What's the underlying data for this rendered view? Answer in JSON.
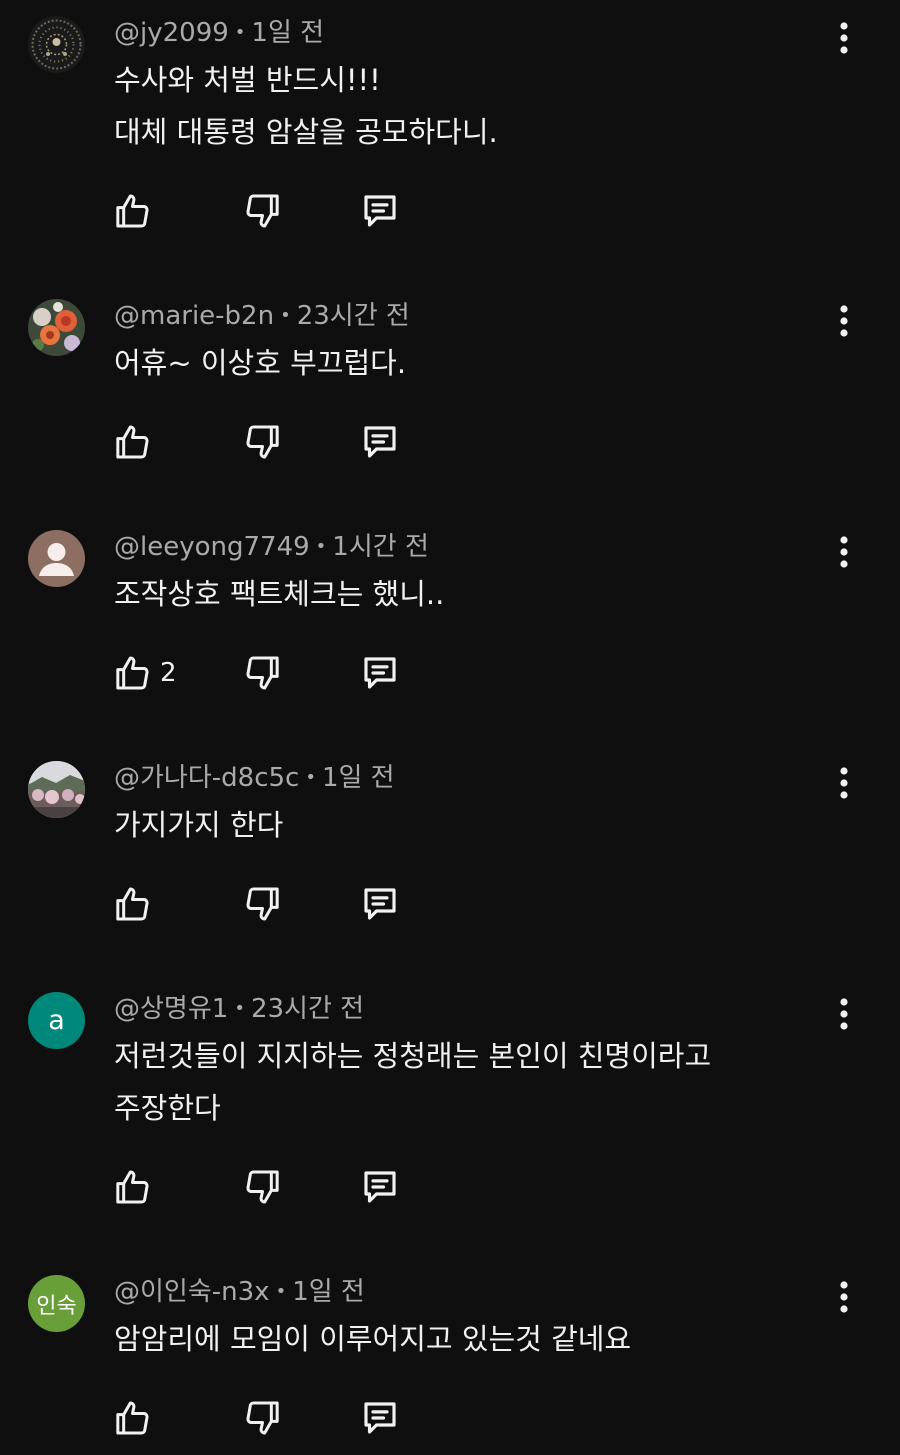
{
  "comments": [
    {
      "handle": "@jy2099",
      "time": "1일 전",
      "lines": [
        "수사와 처벌 반드시!!!",
        "대체 대통령 암살을 공모하다니."
      ],
      "likes": "",
      "avatar": {
        "type": "image",
        "icon": "dark-pattern-avatar"
      }
    },
    {
      "handle": "@marie-b2n",
      "time": "23시간 전",
      "lines": [
        "어휴~ 이상호 부끄럽다."
      ],
      "likes": "",
      "avatar": {
        "type": "image",
        "icon": "flowers-avatar"
      }
    },
    {
      "handle": "@leeyong7749",
      "time": "1시간 전",
      "lines": [
        "조작상호 팩트체크는 했니.."
      ],
      "likes": "2",
      "avatar": {
        "type": "image",
        "icon": "default-person-avatar"
      }
    },
    {
      "handle": "@가나다-d8c5c",
      "time": "1일 전",
      "lines": [
        "가지가지 한다"
      ],
      "likes": "",
      "avatar": {
        "type": "image",
        "icon": "landscape-avatar"
      }
    },
    {
      "handle": "@상명유1",
      "time": "23시간 전",
      "lines": [
        "저런것들이 지지하는 정청래는 본인이 친명이라고",
        "주장한다"
      ],
      "likes": "",
      "avatar": {
        "type": "letter",
        "text": "a",
        "color": "#00897b"
      }
    },
    {
      "handle": "@이인숙-n3x",
      "time": "1일 전",
      "lines": [
        "암암리에 모임이 이루어지고 있는것 같네요"
      ],
      "likes": "",
      "avatar": {
        "type": "letter",
        "text": "인숙",
        "color": "#689f38"
      }
    }
  ],
  "separator": "•",
  "icons": {
    "like": "thumbs-up-icon",
    "dislike": "thumbs-down-icon",
    "reply": "reply-comment-icon",
    "more": "more-vertical-icon"
  },
  "colors": {
    "background": "#0f0f0f",
    "text": "#f1f1f1",
    "meta": "#aaaaaa"
  }
}
